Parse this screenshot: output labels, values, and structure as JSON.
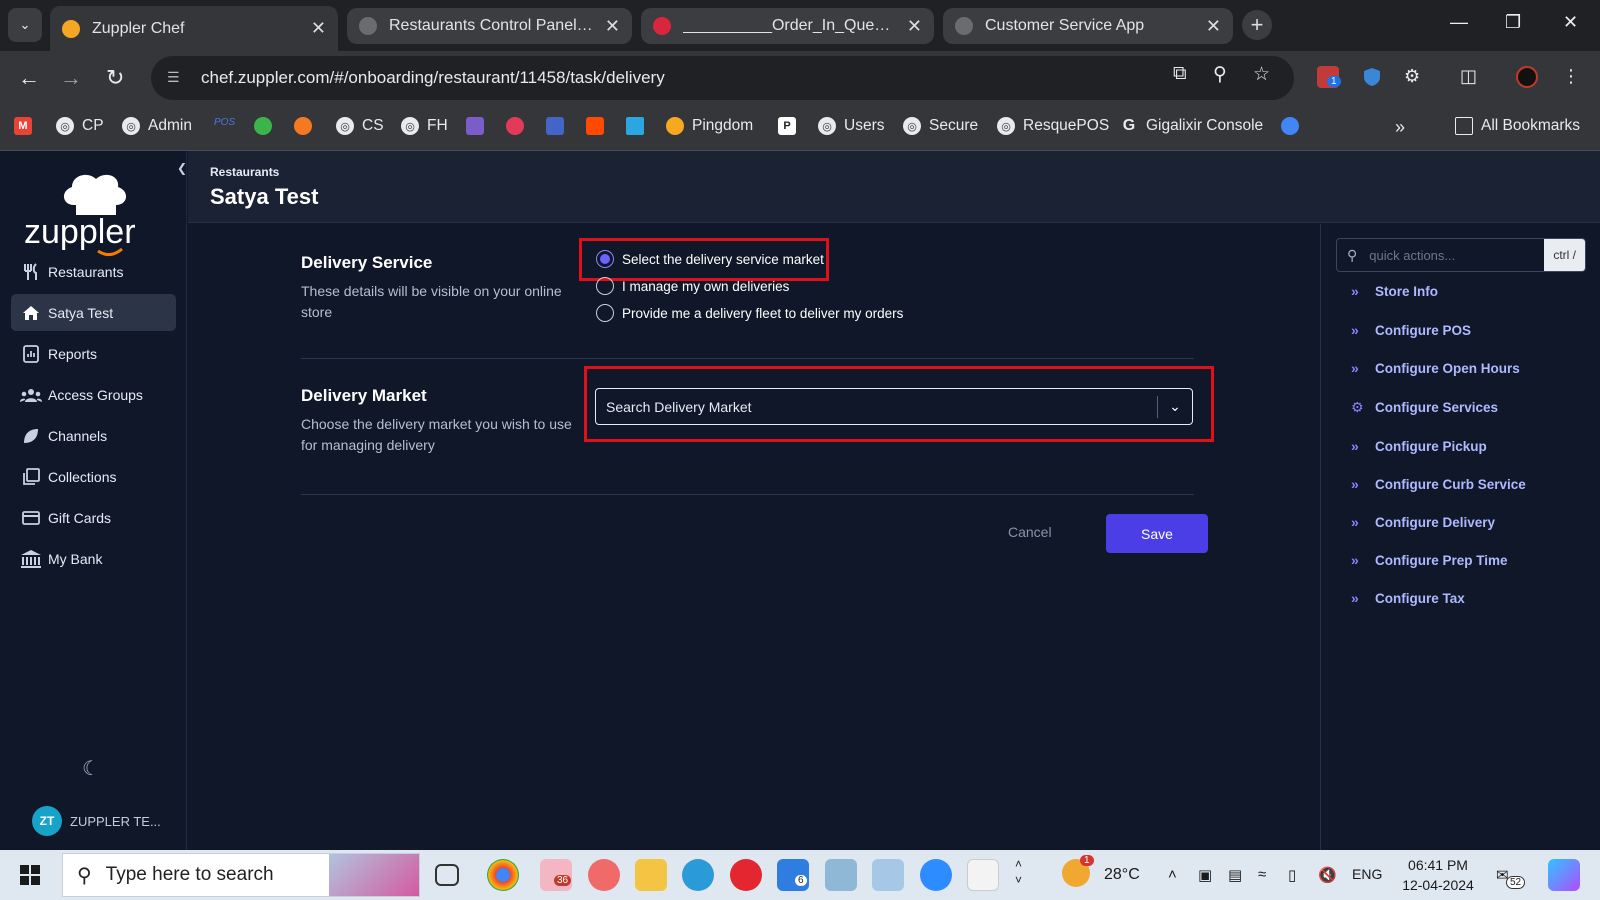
{
  "browser": {
    "tabs": [
      {
        "title": "Zuppler Chef",
        "active": true
      },
      {
        "title": "Restaurants Control Panel βeta",
        "active": false
      },
      {
        "title": "__________Order_In_Queue!!__________",
        "active": false
      },
      {
        "title": "Customer Service App",
        "active": false
      }
    ],
    "url": "chef.zuppler.com/#/onboarding/restaurant/11458/task/delivery",
    "extension_badge": "1",
    "bookmarks": [
      "CP",
      "Admin",
      "POS",
      "CS",
      "FH",
      "Pingdom",
      "Users",
      "Secure",
      "ResquePOS",
      "Gigalixir Console"
    ],
    "all_bookmarks": "All Bookmarks"
  },
  "sidebar": {
    "logo_text": "zuppler",
    "items": [
      {
        "label": "Restaurants",
        "icon": "utensils-icon"
      },
      {
        "label": "Satya Test",
        "icon": "home-icon",
        "active": true
      },
      {
        "label": "Reports",
        "icon": "report-icon"
      },
      {
        "label": "Access Groups",
        "icon": "group-icon"
      },
      {
        "label": "Channels",
        "icon": "leaf-icon"
      },
      {
        "label": "Collections",
        "icon": "collection-icon"
      },
      {
        "label": "Gift Cards",
        "icon": "card-icon"
      },
      {
        "label": "My Bank",
        "icon": "bank-icon"
      }
    ],
    "user_initials": "ZT",
    "user_name": "ZUPPLER TE..."
  },
  "header": {
    "breadcrumb": "Restaurants",
    "title": "Satya Test"
  },
  "delivery_service": {
    "title": "Delivery Service",
    "description": "These details will be visible on your online store",
    "options": [
      {
        "label": "Select the delivery service market",
        "checked": true
      },
      {
        "label": "I manage my own deliveries",
        "checked": false
      },
      {
        "label": "Provide me a delivery fleet to deliver my orders",
        "checked": false
      }
    ]
  },
  "delivery_market": {
    "title": "Delivery Market",
    "description": "Choose the delivery market you wish to use for managing delivery",
    "placeholder": "Search Delivery Market"
  },
  "actions": {
    "cancel": "Cancel",
    "save": "Save"
  },
  "quick_actions": {
    "placeholder": "quick actions...",
    "shortcut": "ctrl /",
    "links": [
      "Store Info",
      "Configure POS",
      "Configure Open Hours",
      "Configure Services",
      "Configure Pickup",
      "Configure Curb Service",
      "Configure Delivery",
      "Configure Prep Time",
      "Configure Tax"
    ]
  },
  "taskbar": {
    "search_placeholder": "Type here to search",
    "slack_badge": "36",
    "todo_badge": "6",
    "weather_badge": "1",
    "temperature": "28°C",
    "language": "ENG",
    "time": "06:41 PM",
    "date": "12-04-2024",
    "notification_count": "52"
  },
  "colors": {
    "accent": "#4b3ee6",
    "highlight": "#e0101a",
    "link": "#aeb9ff",
    "background": "#0f1729"
  }
}
